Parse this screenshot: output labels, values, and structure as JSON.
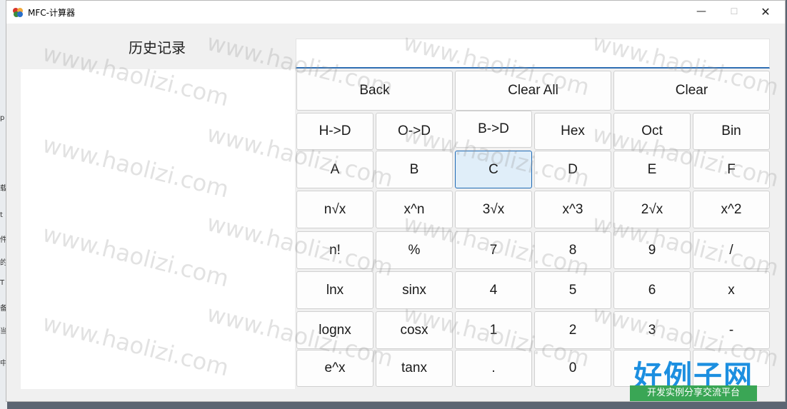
{
  "window": {
    "title": "MFC-计算器",
    "controls": {
      "minimize": "—",
      "maximize": "☐",
      "close": "✕"
    }
  },
  "history": {
    "label": "历史记录"
  },
  "display": {
    "value": ""
  },
  "buttons": {
    "back": "Back",
    "clear_all": "Clear All",
    "clear": "Clear",
    "h_to_d": "H->D",
    "o_to_d": "O->D",
    "b_to_d": "B->D",
    "hex": "Hex",
    "oct": "Oct",
    "bin": "Bin",
    "a": "A",
    "b": "B",
    "c": "C",
    "d": "D",
    "e": "E",
    "f": "F",
    "nth_root": "n√x",
    "x_pow_n": "x^n",
    "cube_root": "3√x",
    "x_cubed": "x^3",
    "sqrt": "2√x",
    "x_squared": "x^2",
    "factorial": "n!",
    "percent": "%",
    "seven": "7",
    "eight": "8",
    "nine": "9",
    "divide": "/",
    "ln": "lnx",
    "sin": "sinx",
    "four": "4",
    "five": "5",
    "six": "6",
    "multiply": "x",
    "log": "lognx",
    "cos": "cosx",
    "one": "1",
    "two": "2",
    "three": "3",
    "minus": "-",
    "exp": "e^x",
    "tan": "tanx",
    "dot": ".",
    "zero": "0"
  },
  "desktop_edge_glyphs": [
    "p",
    "载",
    "t",
    "件",
    "的",
    "T",
    "备",
    "当",
    "中"
  ],
  "watermark": "www.haolizi.com",
  "logo": {
    "main": "好例子网",
    "sub": "开发实例分享交流平台"
  },
  "colors": {
    "display_underline": "#2f6fb3",
    "focused_button": "#e0eef9",
    "logo_blue": "#1c8fe0",
    "logo_green": "#3aa655"
  }
}
